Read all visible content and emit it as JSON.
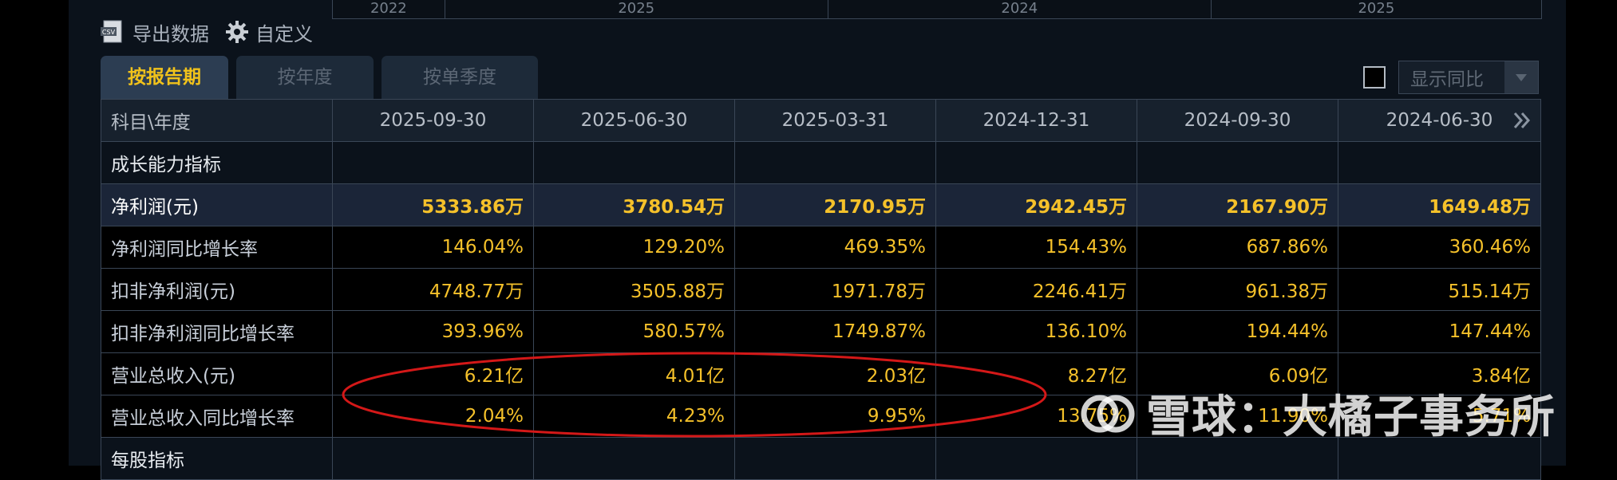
{
  "years_strip": [
    "2022",
    "2025",
    "2024",
    "2025"
  ],
  "toolbar": {
    "export_label": "导出数据",
    "custom_label": "自定义"
  },
  "tabs": [
    "按报告期",
    "按年度",
    "按单季度"
  ],
  "yoy_select": {
    "label": "显示同比"
  },
  "table": {
    "header_label": "科目\\年度",
    "dates": [
      "2025-09-30",
      "2025-06-30",
      "2025-03-31",
      "2024-12-31",
      "2024-09-30",
      "2024-06-30"
    ],
    "rows": [
      {
        "label": "成长能力指标",
        "values": [
          "",
          "",
          "",
          "",
          "",
          ""
        ]
      },
      {
        "label": "净利润(元)",
        "values": [
          "5333.86万",
          "3780.54万",
          "2170.95万",
          "2942.45万",
          "2167.90万",
          "1649.48万"
        ]
      },
      {
        "label": "净利润同比增长率",
        "values": [
          "146.04%",
          "129.20%",
          "469.35%",
          "154.43%",
          "687.86%",
          "360.46%"
        ]
      },
      {
        "label": "扣非净利润(元)",
        "values": [
          "4748.77万",
          "3505.88万",
          "1971.78万",
          "2246.41万",
          "961.38万",
          "515.14万"
        ]
      },
      {
        "label": "扣非净利润同比增长率",
        "values": [
          "393.96%",
          "580.57%",
          "1749.87%",
          "136.10%",
          "194.44%",
          "147.44%"
        ]
      },
      {
        "label": "营业总收入(元)",
        "values": [
          "6.21亿",
          "4.01亿",
          "2.03亿",
          "8.27亿",
          "6.09亿",
          "3.84亿"
        ]
      },
      {
        "label": "营业总收入同比增长率",
        "values": [
          "2.04%",
          "4.23%",
          "9.95%",
          "13.75%",
          "11.90%",
          "5.71%"
        ]
      },
      {
        "label": "每股指标",
        "values": [
          "",
          "",
          "",
          "",
          "",
          ""
        ]
      }
    ]
  },
  "watermark": "雪球：大橘子事务所",
  "colors": {
    "accent": "#f5c12a",
    "highlight_row": "#1b2538",
    "annotation": "#d41818"
  }
}
